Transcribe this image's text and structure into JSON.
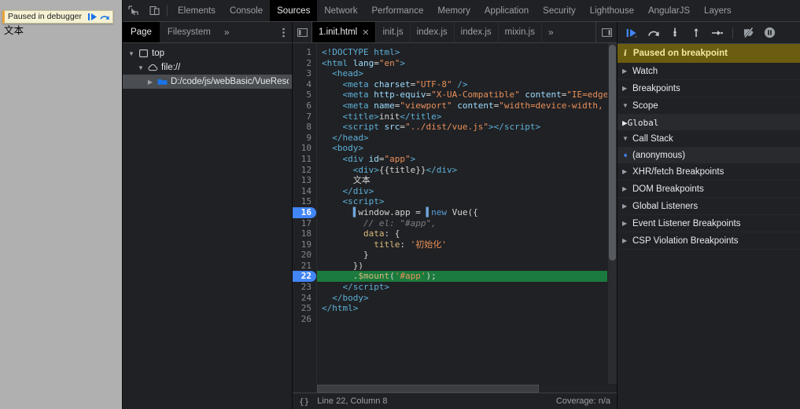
{
  "page_overlay": {
    "banner_text": "Paused in debugger",
    "resume_icon": "resume-icon",
    "step_icon": "step-over-icon",
    "page_body_text": "文本"
  },
  "main_tabs": [
    {
      "label": "Elements",
      "active": false
    },
    {
      "label": "Console",
      "active": false
    },
    {
      "label": "Sources",
      "active": true
    },
    {
      "label": "Network",
      "active": false
    },
    {
      "label": "Performance",
      "active": false
    },
    {
      "label": "Memory",
      "active": false
    },
    {
      "label": "Application",
      "active": false
    },
    {
      "label": "Security",
      "active": false
    },
    {
      "label": "Lighthouse",
      "active": false
    },
    {
      "label": "AngularJS",
      "active": false
    },
    {
      "label": "Layers",
      "active": false
    }
  ],
  "toolbar_icons": {
    "inspect": "inspect-element-icon",
    "device": "device-toolbar-icon",
    "kebab": "more-options-icon"
  },
  "navigator": {
    "tabs": [
      {
        "label": "Page",
        "active": true
      },
      {
        "label": "Filesystem",
        "active": false
      }
    ],
    "overflow": "»",
    "tree": [
      {
        "label": "top",
        "icon": "frame-icon",
        "depth": 0,
        "expanded": true,
        "selected": false
      },
      {
        "label": "file://",
        "icon": "cloud-icon",
        "depth": 1,
        "expanded": true,
        "selected": false
      },
      {
        "label": "D:/code/js/webBasic/VueResour",
        "icon": "folder-icon",
        "depth": 2,
        "expanded": false,
        "selected": true
      }
    ]
  },
  "file_tabs": {
    "panel_icon": "show-navigator-icon",
    "tabs": [
      {
        "label": "1.init.html",
        "active": true,
        "closable": true
      },
      {
        "label": "init.js",
        "active": false,
        "closable": false
      },
      {
        "label": "index.js",
        "active": false,
        "closable": false
      },
      {
        "label": "index.js",
        "active": false,
        "closable": false
      },
      {
        "label": "mixin.js",
        "active": false,
        "closable": false
      }
    ],
    "overflow": "»",
    "right_icon": "show-debugger-icon"
  },
  "code": {
    "lines": [
      {
        "n": 1,
        "breakpoint": false,
        "executing": false
      },
      {
        "n": 2,
        "breakpoint": false,
        "executing": false
      },
      {
        "n": 3,
        "breakpoint": false,
        "executing": false
      },
      {
        "n": 4,
        "breakpoint": false,
        "executing": false
      },
      {
        "n": 5,
        "breakpoint": false,
        "executing": false
      },
      {
        "n": 6,
        "breakpoint": false,
        "executing": false
      },
      {
        "n": 7,
        "breakpoint": false,
        "executing": false
      },
      {
        "n": 8,
        "breakpoint": false,
        "executing": false
      },
      {
        "n": 9,
        "breakpoint": false,
        "executing": false
      },
      {
        "n": 10,
        "breakpoint": false,
        "executing": false
      },
      {
        "n": 11,
        "breakpoint": false,
        "executing": false
      },
      {
        "n": 12,
        "breakpoint": false,
        "executing": false
      },
      {
        "n": 13,
        "breakpoint": false,
        "executing": false
      },
      {
        "n": 14,
        "breakpoint": false,
        "executing": false
      },
      {
        "n": 15,
        "breakpoint": false,
        "executing": false
      },
      {
        "n": 16,
        "breakpoint": true,
        "executing": false
      },
      {
        "n": 17,
        "breakpoint": false,
        "executing": false
      },
      {
        "n": 18,
        "breakpoint": false,
        "executing": false
      },
      {
        "n": 19,
        "breakpoint": false,
        "executing": false
      },
      {
        "n": 20,
        "breakpoint": false,
        "executing": false
      },
      {
        "n": 21,
        "breakpoint": false,
        "executing": false
      },
      {
        "n": 22,
        "breakpoint": true,
        "executing": true
      },
      {
        "n": 23,
        "breakpoint": false,
        "executing": false
      },
      {
        "n": 24,
        "breakpoint": false,
        "executing": false
      },
      {
        "n": 25,
        "breakpoint": false,
        "executing": false
      },
      {
        "n": 26,
        "breakpoint": false,
        "executing": false
      }
    ],
    "text": [
      "<!DOCTYPE html>",
      "<html lang=\"en\">",
      "  <head>",
      "    <meta charset=\"UTF-8\" />",
      "    <meta http-equiv=\"X-UA-Compatible\" content=\"IE=edge\" /",
      "    <meta name=\"viewport\" content=\"width=device-width, ini",
      "    <title>init</title>",
      "    <script src=\"../dist/vue.js\"></script>",
      "  </head>",
      "  <body>",
      "    <div id=\"app\">",
      "      <div>{{title}}</div>",
      "      文本",
      "    </div>",
      "    <script>",
      "      window.app = new Vue({",
      "        // el: \"#app\",",
      "        data: {",
      "          title: '初始化'",
      "        }",
      "      })",
      "      .$mount('#app');",
      "    </script>",
      "  </body>",
      "</html>",
      ""
    ]
  },
  "statusbar": {
    "pretty_print": "{}",
    "position": "Line 22, Column 8",
    "coverage": "Coverage: n/a"
  },
  "debugger": {
    "controls": [
      {
        "name": "resume-script-execution",
        "active": true
      },
      {
        "name": "step-over-next-function-call",
        "active": false
      },
      {
        "name": "step-into-next-function-call",
        "active": false
      },
      {
        "name": "step-out-of-current-function",
        "active": false
      },
      {
        "name": "step",
        "active": false
      },
      {
        "name": "deactivate-breakpoints",
        "active": false
      },
      {
        "name": "pause-on-exceptions",
        "active": false
      }
    ],
    "paused_banner": {
      "icon": "info-icon",
      "text": "Paused on breakpoint"
    },
    "sections": [
      {
        "label": "Watch",
        "expanded": false,
        "type": "section"
      },
      {
        "label": "Breakpoints",
        "expanded": false,
        "type": "section"
      },
      {
        "label": "Scope",
        "expanded": true,
        "type": "section"
      },
      {
        "label": "Global",
        "expanded": false,
        "type": "mono-sub"
      },
      {
        "label": "Call Stack",
        "expanded": true,
        "type": "section"
      },
      {
        "label": "(anonymous)",
        "expanded": false,
        "type": "frame"
      },
      {
        "label": "XHR/fetch Breakpoints",
        "expanded": false,
        "type": "section"
      },
      {
        "label": "DOM Breakpoints",
        "expanded": false,
        "type": "section"
      },
      {
        "label": "Global Listeners",
        "expanded": false,
        "type": "section"
      },
      {
        "label": "Event Listener Breakpoints",
        "expanded": false,
        "type": "section"
      },
      {
        "label": "CSP Violation Breakpoints",
        "expanded": false,
        "type": "section"
      }
    ]
  },
  "colors": {
    "accent_blue": "#4285f4",
    "exec_line_green": "#1b7a3d",
    "paused_banner": "#6b5d10",
    "panel_bg": "#202124",
    "page_bg": "#b0b0b0"
  }
}
